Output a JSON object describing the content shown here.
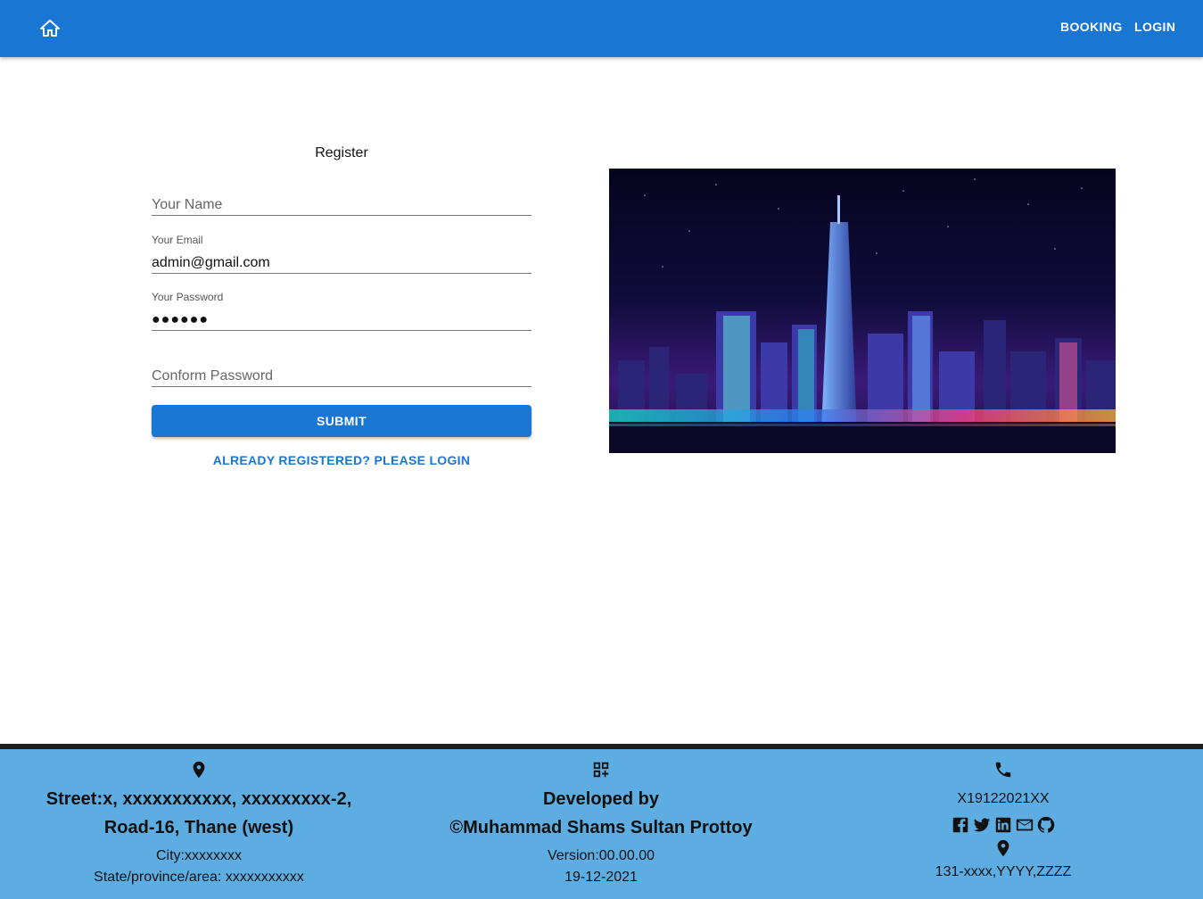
{
  "appbar": {
    "home_icon": "home-icon",
    "nav": [
      {
        "label": "BOOKING"
      },
      {
        "label": "LOGIN"
      }
    ],
    "color": "#1976d2"
  },
  "register": {
    "title": "Register",
    "name_placeholder": "Your Name",
    "email_label": "Your Email",
    "email_value": "admin@gmail.com",
    "password_label": "Your Password",
    "password_value": "●●●●●●",
    "confirm_placeholder": "Conform Password",
    "submit_label": "SUBMIT",
    "login_link": "ALREADY REGISTERED? PLEASE LOGIN"
  },
  "hero_image": {
    "subject": "neon city skyline at night"
  },
  "footer": {
    "background": "#5dade2",
    "address": {
      "icon": "location-pin-icon",
      "street": "Street:x, xxxxxxxxxxx, xxxxxxxxx-2, Road-16, Thane (west)",
      "city": "City:xxxxxxxx",
      "state": "State/province/area: xxxxxxxxxxx"
    },
    "developer": {
      "icon": "qr-add-icon",
      "heading": "Developed by",
      "name": "©Muhammad Shams Sultan Prottoy",
      "version": "Version:00.00.00",
      "date": "19-12-2021"
    },
    "contact": {
      "phone_icon": "phone-icon",
      "phone": "X19122021XX",
      "social_icons": [
        "facebook-icon",
        "twitter-icon",
        "linkedin-icon",
        "email-icon",
        "github-icon"
      ],
      "location_icon": "location-pin-icon",
      "postal": "131-xxxx,YYYY,ZZZZ"
    }
  }
}
